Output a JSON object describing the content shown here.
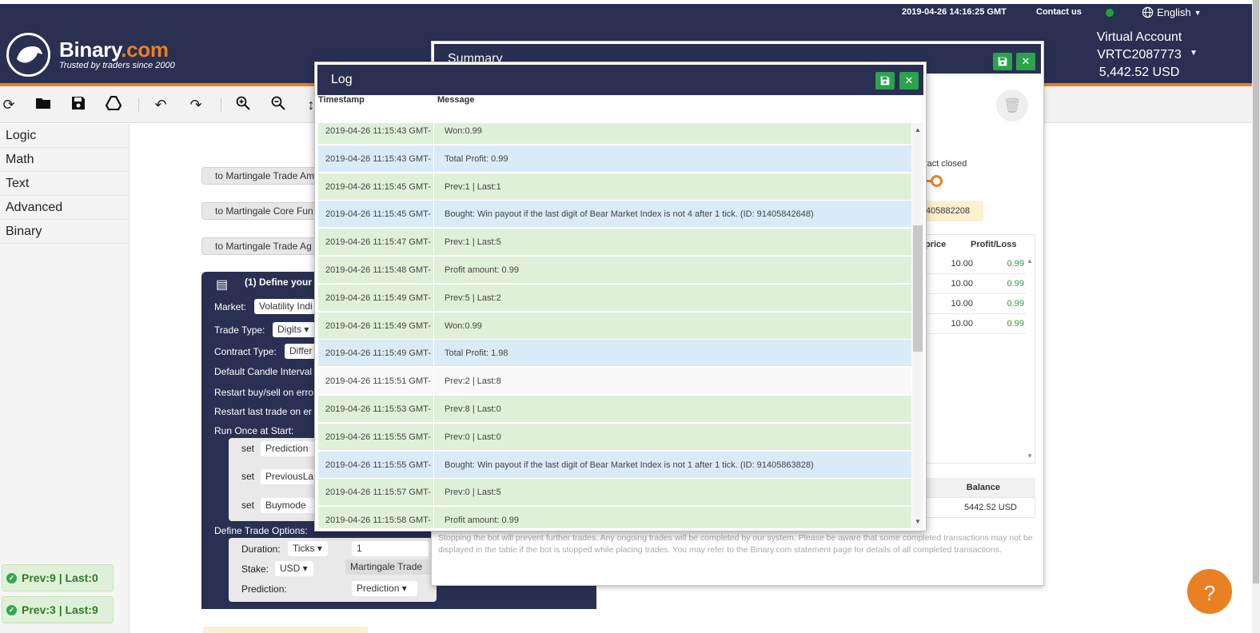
{
  "topbar": {
    "datetime": "2019-04-26 14:16:25 GMT",
    "contact": "Contact us",
    "language": "English"
  },
  "header": {
    "brand_main": "Binary",
    "brand_dot": ".com",
    "tagline": "Trusted by traders since 2000",
    "account_type": "Virtual Account",
    "account_id": "VRTC2087773",
    "balance": "5,442.52 USD"
  },
  "toolbar": {
    "icons": [
      "reload-icon",
      "open-folder-icon",
      "save-icon",
      "google-drive-icon",
      "undo-icon",
      "redo-icon",
      "zoom-in-icon",
      "zoom-out-icon",
      "sort-icon"
    ]
  },
  "flyout": {
    "items": [
      {
        "label": "Logic"
      },
      {
        "label": "Math"
      },
      {
        "label": "Text"
      },
      {
        "label": "Advanced"
      },
      {
        "label": "Binary"
      }
    ]
  },
  "workspace": {
    "pills": [
      {
        "label": "to Martingale Trade Am"
      },
      {
        "label": "to Martingale Core Fun"
      },
      {
        "label": "to Martingale Trade Ag"
      }
    ],
    "block_title": "(1) Define your t",
    "market_label": "Market:",
    "market_value": "Volatility Indi",
    "trade_type_label": "Trade Type:",
    "trade_type_value": "Digits",
    "contract_type_label": "Contract Type:",
    "contract_type_value": "Differ",
    "candle_label": "Default Candle Interval",
    "restart_buy_label": "Restart buy/sell on erro",
    "restart_last_label": "Restart last trade on er",
    "run_once_label": "Run Once at Start:",
    "set_rows": [
      {
        "set": "set",
        "var": "Prediction"
      },
      {
        "set": "set",
        "var": "PreviousLa"
      },
      {
        "set": "set",
        "var": "Buymode"
      }
    ],
    "define_options_label": "Define Trade Options:",
    "duration_label": "Duration:",
    "duration_unit": "Ticks",
    "duration_value": "1",
    "stake_label": "Stake:",
    "stake_currency": "USD",
    "stake_block": "Martingale Trade",
    "prediction_label": "Prediction:",
    "prediction_value": "Prediction"
  },
  "status_pills": [
    {
      "text": "Prev:9 | Last:0"
    },
    {
      "text": "Prev:3 | Last:9"
    }
  ],
  "summary": {
    "title": "Summary",
    "contract_closed": "ract closed",
    "contract_id": "405882208",
    "col_price": "price",
    "col_profit": "Profit/Loss",
    "rows": [
      {
        "price": "10.00",
        "profit": "0.99"
      },
      {
        "price": "10.00",
        "profit": "0.99"
      },
      {
        "price": "10.00",
        "profit": "0.99"
      },
      {
        "price": "10.00",
        "profit": "0.99"
      }
    ],
    "balance_label": "Balance",
    "balance_value": "5442.52 USD",
    "note": "Stopping the bot will prevent further trades. Any ongoing trades will be completed by our system. Please be aware that some completed transactions may not be displayed in the table if the bot is stopped while placing trades. You may refer to the Binary.com statement page for details of all completed transactions."
  },
  "log": {
    "title": "Log",
    "col_timestamp": "Timestamp",
    "col_message": "Message",
    "rows": [
      {
        "ts": "2019-04-26 11:15:43 GMT-",
        "msg": "Won:0.99",
        "kind": "green"
      },
      {
        "ts": "2019-04-26 11:15:43 GMT-",
        "msg": "Total Profit: 0.99",
        "kind": "blue"
      },
      {
        "ts": "2019-04-26 11:15:45 GMT-",
        "msg": "Prev:1 | Last:1",
        "kind": "green"
      },
      {
        "ts": "2019-04-26 11:15:45 GMT-",
        "msg": "Bought: Win payout if the last digit of Bear Market Index is not 4 after 1 tick. (ID: 91405842648)",
        "kind": "blue"
      },
      {
        "ts": "2019-04-26 11:15:47 GMT-",
        "msg": "Prev:1 | Last:5",
        "kind": "green"
      },
      {
        "ts": "2019-04-26 11:15:48 GMT-",
        "msg": "Profit amount: 0.99",
        "kind": "green"
      },
      {
        "ts": "2019-04-26 11:15:49 GMT-",
        "msg": "Prev:5 | Last:2",
        "kind": "green"
      },
      {
        "ts": "2019-04-26 11:15:49 GMT-",
        "msg": "Won:0.99",
        "kind": "green"
      },
      {
        "ts": "2019-04-26 11:15:49 GMT-",
        "msg": "Total Profit: 1.98",
        "kind": "blue"
      },
      {
        "ts": "2019-04-26 11:15:51 GMT-",
        "msg": "Prev:2 | Last:8",
        "kind": "white"
      },
      {
        "ts": "2019-04-26 11:15:53 GMT-",
        "msg": "Prev:8 | Last:0",
        "kind": "green"
      },
      {
        "ts": "2019-04-26 11:15:55 GMT-",
        "msg": "Prev:0 | Last:0",
        "kind": "green"
      },
      {
        "ts": "2019-04-26 11:15:55 GMT-",
        "msg": "Bought: Win payout if the last digit of Bear Market Index is not 1 after 1 tick. (ID: 91405863828)",
        "kind": "blue"
      },
      {
        "ts": "2019-04-26 11:15:57 GMT-",
        "msg": "Prev:0 | Last:5",
        "kind": "green"
      },
      {
        "ts": "2019-04-26 11:15:58 GMT-",
        "msg": "Profit amount: 0.99",
        "kind": "green"
      }
    ]
  },
  "help_label": "?",
  "colors": {
    "navy": "#2a3052",
    "orange": "#e98024",
    "green_btn": "#2ba24c",
    "log_green": "#dff0d8",
    "log_blue": "#d9ebf6"
  }
}
